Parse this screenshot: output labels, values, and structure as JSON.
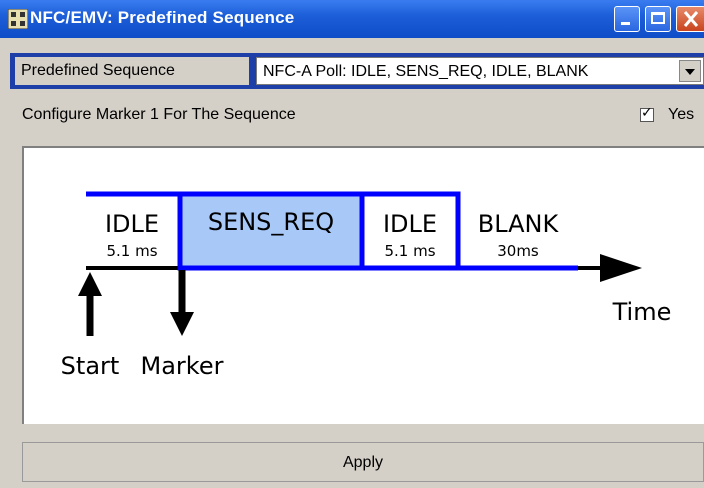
{
  "window": {
    "title": "NFC/EMV: Predefined Sequence"
  },
  "sequence": {
    "label": "Predefined Sequence",
    "selected": "NFC-A Poll: IDLE, SENS_REQ, IDLE, BLANK"
  },
  "marker_config": {
    "label": "Configure Marker 1 For The Sequence",
    "checkbox_label": "Yes",
    "checked": true
  },
  "diagram": {
    "segments": [
      {
        "name": "IDLE",
        "duration": "5.1 ms"
      },
      {
        "name": "SENS_REQ",
        "duration": ""
      },
      {
        "name": "IDLE",
        "duration": "5.1 ms"
      },
      {
        "name": "BLANK",
        "duration": "30ms"
      }
    ],
    "time_label": "Time",
    "start_label": "Start",
    "marker_label": "Marker"
  },
  "apply_label": "Apply",
  "colors": {
    "title_bar": "#1d5fd8",
    "signal": "#0000ff",
    "sens_fill": "#a8c8f8"
  }
}
